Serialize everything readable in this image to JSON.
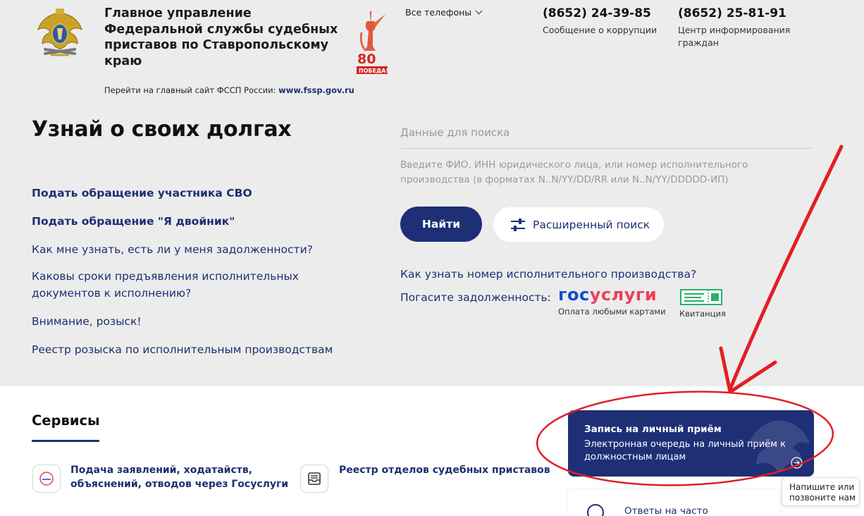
{
  "header": {
    "org_name": "Главное управление Федеральной службы судебных приставов по Ставропольскому краю",
    "main_site_label": "Перейти на главный сайт ФССП России:",
    "main_site_link": "www.fssp.gov.ru",
    "victory_logo_text": "80 ПОБЕДА!",
    "phones_toggle": "Все телефоны",
    "phones": [
      {
        "number": "(8652) 24-39-85",
        "caption": "Сообщение о коррупции"
      },
      {
        "number": "(8652) 25-81-91",
        "caption": "Центр информирования граждан"
      }
    ]
  },
  "hero": {
    "headline": "Узнай о своих долгах",
    "links": [
      {
        "label": "Подать обращение участника СВО",
        "bold": true
      },
      {
        "label": "Подать обращение \"Я двойник\"",
        "bold": true
      },
      {
        "label": "Как мне узнать, есть ли у меня задолженности?",
        "bold": false
      },
      {
        "label": "Каковы сроки предъявления исполнительных документов к исполнению?",
        "bold": false
      },
      {
        "label": "Внимание, розыск!",
        "bold": false
      },
      {
        "label": "Реестр розыска по исполнительным производствам",
        "bold": false
      }
    ]
  },
  "search": {
    "placeholder": "Данные для поиска",
    "hint": "Введите ФИО, ИНН юридического лица, или номер исполнительного производства (в форматах N..N/YY/DD/RR или N..N/YY/DDDDD-ИП)",
    "find_button": "Найти",
    "advanced_button": "Расширенный поиск",
    "howto_link": "Как узнать номер исполнительного производства?",
    "pay_label": "Погасите задолженность:",
    "gosuslugi_logo_a": "гос",
    "gosuslugi_logo_b": "услуги",
    "gosuslugi_caption": "Оплата любыми картами",
    "receipt_caption": "Квитанция"
  },
  "services": {
    "title": "Сервисы",
    "items": [
      {
        "label": "Подача заявлений, ходатайств, объяснений, отводов через Госуслуги",
        "icon": "gosuslugi-icon"
      },
      {
        "label": "Реестр отделов судебных приставов",
        "icon": "registry-icon"
      }
    ],
    "appointment_card": {
      "title": "Запись на личный приём",
      "subtitle": "Электронная очередь на личный приём к должностным лицам"
    },
    "faq_label": "Ответы на часто",
    "chat_widget": "Напишите или позвоните нам"
  },
  "colors": {
    "brand_blue": "#1e2f76",
    "link_blue": "#1d2f6f",
    "annotation_red": "#e31e24",
    "background": "#ececec"
  }
}
